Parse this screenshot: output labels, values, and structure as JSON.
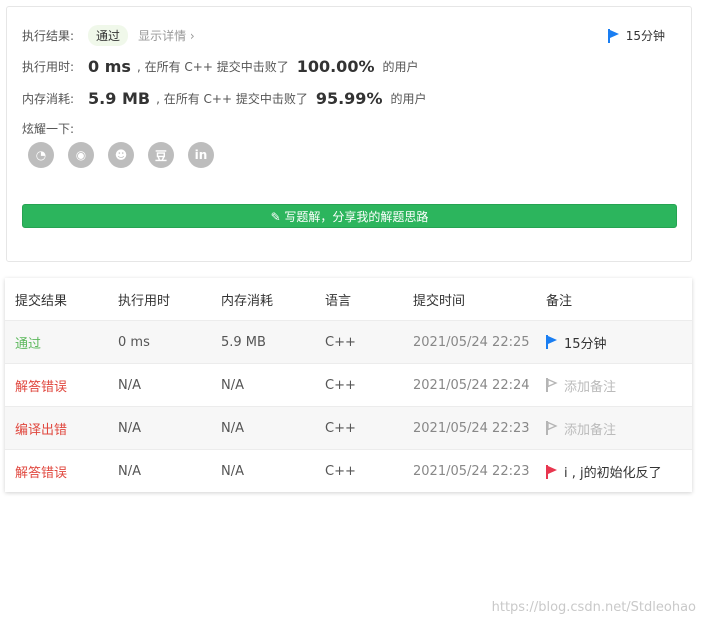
{
  "result": {
    "label": "执行结果:",
    "status": "通过",
    "detail_link": "显示详情 ›",
    "note_time": "15分钟"
  },
  "runtime": {
    "label": "执行用时:",
    "value": "0 ms",
    "beat_text": ", 在所有 C++ 提交中击败了",
    "percent": "100.00%",
    "users_text": "的用户"
  },
  "memory": {
    "label": "内存消耗:",
    "value": "5.9 MB",
    "beat_text": ", 在所有 C++ 提交中击败了",
    "percent": "95.99%",
    "users_text": "的用户"
  },
  "share": {
    "label": "炫耀一下:",
    "icons": [
      "wechat-icon",
      "weibo-icon",
      "qq-icon",
      "douban-icon",
      "linkedin-icon"
    ],
    "glyphs": [
      "◔",
      "◉",
      "☻",
      "豆",
      "in"
    ]
  },
  "solution_button": "✎ 写题解，分享我的解题思路",
  "table": {
    "headers": [
      "提交结果",
      "执行用时",
      "内存消耗",
      "语言",
      "提交时间",
      "备注"
    ],
    "rows": [
      {
        "result": "通过",
        "runtime": "0 ms",
        "memory": "5.9 MB",
        "lang": "C++",
        "time": "2021/05/24 22:25",
        "note": "15分钟",
        "flag": "blue"
      },
      {
        "result": "解答错误",
        "runtime": "N/A",
        "memory": "N/A",
        "lang": "C++",
        "time": "2021/05/24 22:24",
        "note": "添加备注",
        "flag": "gray"
      },
      {
        "result": "编译出错",
        "runtime": "N/A",
        "memory": "N/A",
        "lang": "C++",
        "time": "2021/05/24 22:23",
        "note": "添加备注",
        "flag": "gray"
      },
      {
        "result": "解答错误",
        "runtime": "N/A",
        "memory": "N/A",
        "lang": "C++",
        "time": "2021/05/24 22:23",
        "note": "i , j的初始化反了",
        "flag": "red"
      }
    ]
  },
  "colors": {
    "blue_flag": "#1a7ef2",
    "red_flag": "#e8364f",
    "gray_flag": "#b5b5b5",
    "green": "#2cb55d"
  },
  "watermark": "https://blog.csdn.net/Stdleohao"
}
